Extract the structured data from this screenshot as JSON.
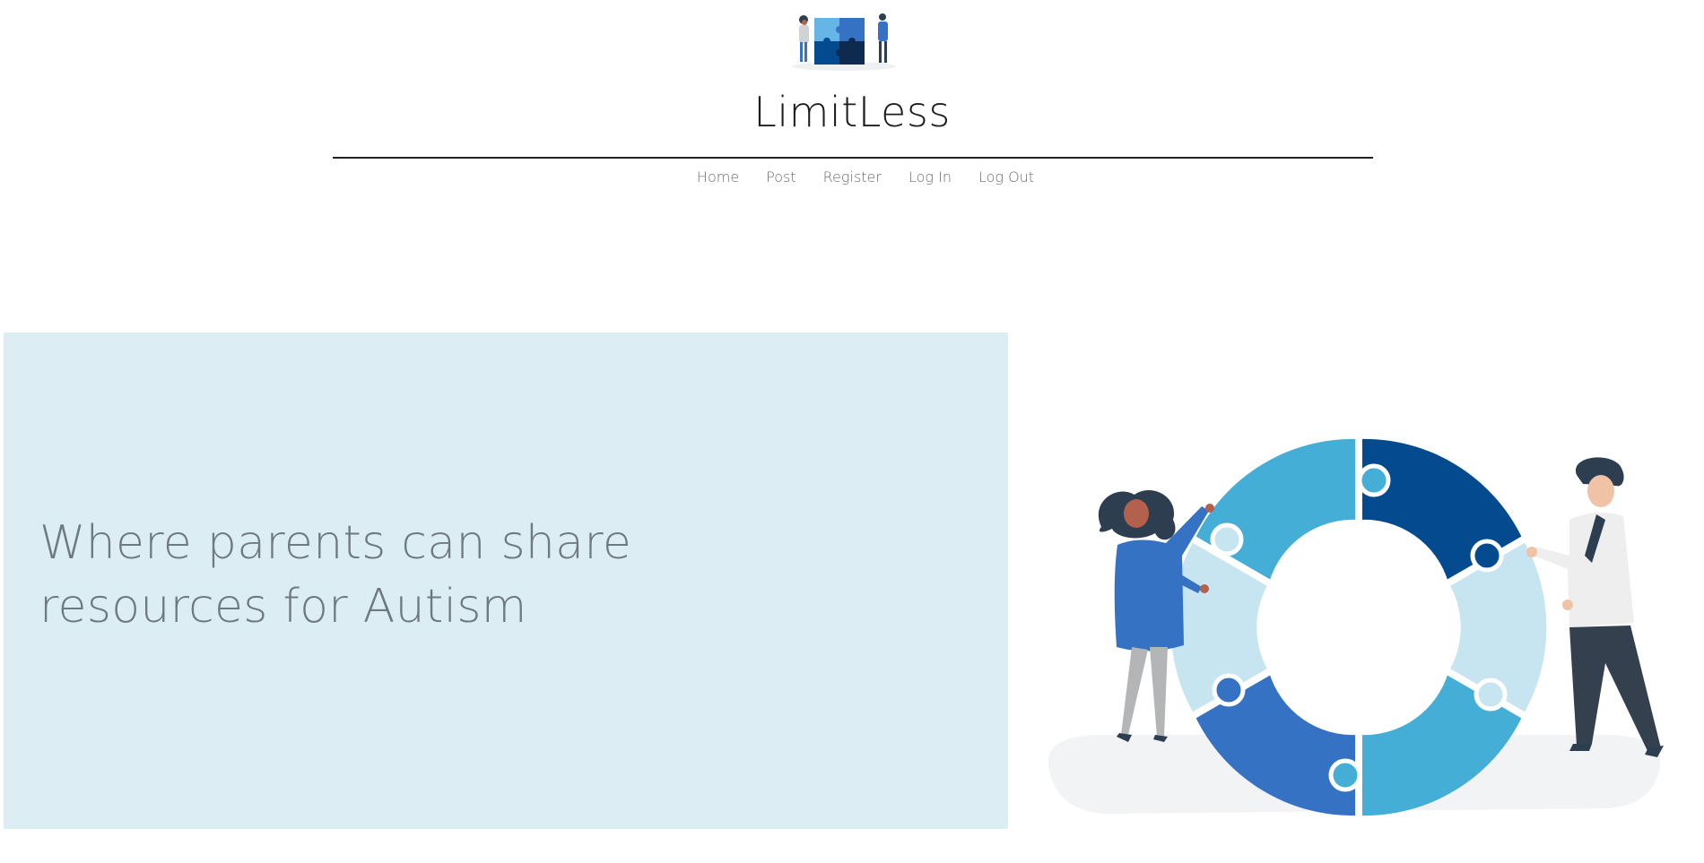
{
  "site": {
    "title": "LimitLess",
    "logo_icon": "puzzle-team-logo-icon"
  },
  "nav": {
    "items": [
      {
        "label": "Home"
      },
      {
        "label": "Post"
      },
      {
        "label": "Register"
      },
      {
        "label": "Log In"
      },
      {
        "label": "Log Out"
      }
    ]
  },
  "hero": {
    "headline": "Where parents can share resources for Autism",
    "illustration_icon": "people-with-puzzle-ring-illustration"
  },
  "colors": {
    "hero_panel": "#dcedf4",
    "puzzle_dark": "#034a8f",
    "puzzle_mid": "#3672c4",
    "puzzle_light": "#44aed6",
    "puzzle_pale": "#c6e5f1"
  }
}
